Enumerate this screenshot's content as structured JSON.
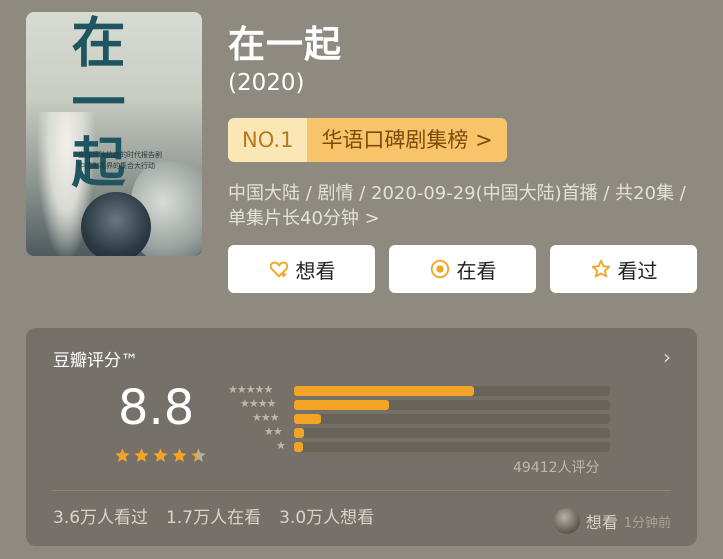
{
  "poster": {
    "title_text": "在一起",
    "subtitle_line1": "全国反映抗疫的时代报告剧",
    "subtitle_line2": "中国影视界的集合大行动"
  },
  "header": {
    "title": "在一起",
    "year": "(2020)"
  },
  "rank": {
    "no": "NO.1",
    "list_label": "华语口碑剧集榜 >"
  },
  "meta": {
    "text": "中国大陆 / 剧情 / 2020-09-29(中国大陆)首播 / 共20集 / 单集片长40分钟 >"
  },
  "actions": {
    "want": "想看",
    "watching": "在看",
    "watched": "看过"
  },
  "rating": {
    "label": "豆瓣评分™",
    "score": "8.8",
    "star_fraction": 0.88,
    "distribution_percent": [
      57.0,
      30.0,
      8.6,
      3.3,
      2.0
    ],
    "count": "49412人评分"
  },
  "stats": {
    "watched": "3.6万人看过",
    "watching": "1.7万人在看",
    "want": "3.0万人想看"
  },
  "recent": {
    "action": "想看",
    "time": "1分钟前"
  },
  "colors": {
    "accent": "#f4a425",
    "rank_no_bg": "#fbe7b6",
    "rank_list_bg": "#f8c46a"
  }
}
